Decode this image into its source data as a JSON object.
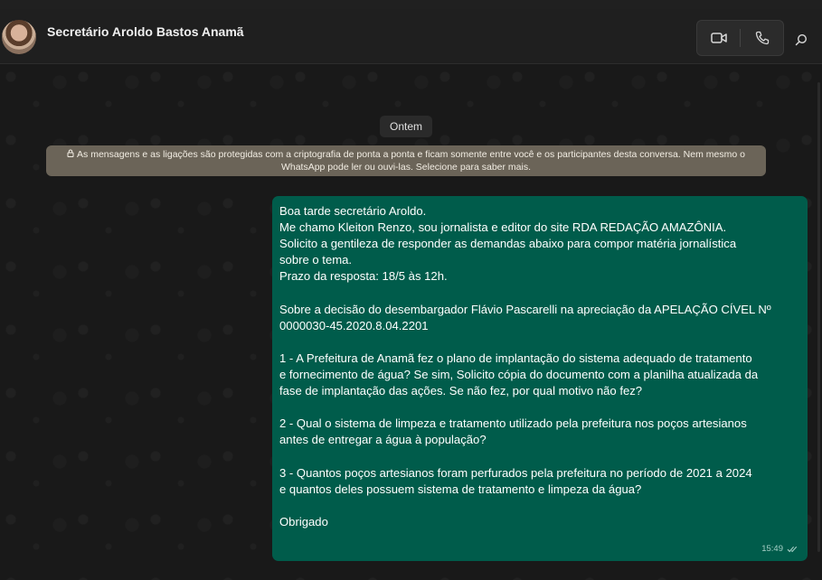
{
  "header": {
    "contact_name": "Secretário Aroldo Bastos Anamã"
  },
  "icons": {
    "video": "video-camera-icon",
    "voice": "phone-icon",
    "search": "search-icon",
    "lock": "lock-icon",
    "read": "double-check-icon"
  },
  "chat": {
    "date_divider": "Ontem",
    "encryption_notice": "As mensagens e as ligações são protegidas com a criptografia de ponta a ponta e ficam somente entre você e os participantes desta conversa. Nem mesmo o WhatsApp pode ler ou ouvi-las. Selecione para saber mais.",
    "message": {
      "text": "Boa tarde secretário Aroldo.\nMe chamo Kleiton Renzo, sou jornalista e editor do site RDA REDAÇÃO AMAZÔNIA.\nSolicito a gentileza de responder as demandas abaixo para compor matéria jornalística\nsobre o tema.\nPrazo da resposta: 18/5 às 12h.\n\nSobre a decisão do desembargador Flávio Pascarelli na apreciação da APELAÇÃO CÍVEL Nº\n0000030-45.2020.8.04.2201\n\n1 - A Prefeitura de Anamã fez o plano de implantação do sistema adequado de tratamento\ne fornecimento de água? Se sim, Solicito cópia do documento com a planilha atualizada da\nfase de implantação das ações. Se não fez, por qual motivo não fez?\n\n2 - Qual o sistema de limpeza e tratamento utilizado pela prefeitura nos poços artesianos\nantes de entregar a água à população?\n\n3 - Quantos poços artesianos foram perfurados pela prefeitura no período de 2021 a 2024\ne quantos deles possuem sistema de tratamento e limpeza da água?\n\nObrigado",
      "time": "15:49"
    }
  },
  "colors": {
    "outgoing_bubble": "#005c4b",
    "encryption_banner": "#6b6458",
    "background": "#191919"
  }
}
